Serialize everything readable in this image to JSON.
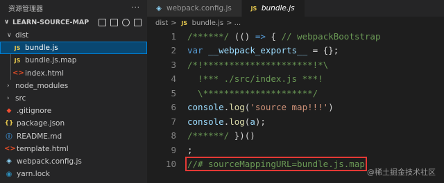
{
  "sidebar": {
    "title": "资源管理器",
    "more": "···",
    "project": "LEARN-SOURCE-MAP",
    "items": [
      {
        "label": "dist",
        "icon": "chevron-down-icon",
        "glyph": "∨"
      },
      {
        "label": "bundle.js",
        "icon": "js-file-icon",
        "glyph": "JS"
      },
      {
        "label": "bundle.js.map",
        "icon": "js-map-file-icon",
        "glyph": "JS"
      },
      {
        "label": "index.html",
        "icon": "html-file-icon",
        "glyph": "<>"
      },
      {
        "label": "node_modules",
        "icon": "chevron-right-icon",
        "glyph": "›"
      },
      {
        "label": "src",
        "icon": "chevron-right-icon",
        "glyph": "›"
      },
      {
        "label": ".gitignore",
        "icon": "git-icon",
        "glyph": "◆"
      },
      {
        "label": "package.json",
        "icon": "json-file-icon",
        "glyph": "{}"
      },
      {
        "label": "README.md",
        "icon": "markdown-file-icon",
        "glyph": "ⓘ"
      },
      {
        "label": "template.html",
        "icon": "html-file-icon",
        "glyph": "<>"
      },
      {
        "label": "webpack.config.js",
        "icon": "webpack-icon",
        "glyph": "◈"
      },
      {
        "label": "yarn.lock",
        "icon": "yarn-icon",
        "glyph": "◉"
      }
    ]
  },
  "tabs": [
    {
      "label": "webpack.config.js",
      "glyph": "◈",
      "active": false
    },
    {
      "label": "bundle.js",
      "glyph": "JS",
      "active": true
    }
  ],
  "breadcrumb": {
    "folder": "dist",
    "sep": ">",
    "file": "bundle.js",
    "more": "> ...",
    "glyph": "JS"
  },
  "code": {
    "lines": [
      {
        "n": "1",
        "parts": [
          [
            "c",
            "/******/ "
          ],
          [
            "p",
            "(() "
          ],
          [
            "k",
            "=>"
          ],
          [
            "p",
            " { "
          ],
          [
            "c",
            "// webpackBootstrap"
          ]
        ]
      },
      {
        "n": "2",
        "parts": [
          [
            "k",
            "var"
          ],
          [
            "p",
            " "
          ],
          [
            "v",
            "__webpack_exports__"
          ],
          [
            "p",
            " = {};"
          ]
        ]
      },
      {
        "n": "3",
        "parts": [
          [
            "c",
            "/*!*********************!*\\"
          ]
        ]
      },
      {
        "n": "4",
        "parts": [
          [
            "c",
            "  !*** ./src/index.js ***!"
          ]
        ]
      },
      {
        "n": "5",
        "parts": [
          [
            "c",
            "  \\*********************/"
          ]
        ]
      },
      {
        "n": "6",
        "parts": [
          [
            "v",
            "console"
          ],
          [
            "p",
            "."
          ],
          [
            "f",
            "log"
          ],
          [
            "p",
            "("
          ],
          [
            "s",
            "'source map!!!'"
          ],
          [
            "p",
            ")"
          ]
        ]
      },
      {
        "n": "7",
        "parts": [
          [
            "v",
            "console"
          ],
          [
            "p",
            "."
          ],
          [
            "f",
            "log"
          ],
          [
            "p",
            "("
          ],
          [
            "v",
            "a"
          ],
          [
            "p",
            ");"
          ]
        ]
      },
      {
        "n": "8",
        "parts": [
          [
            "c",
            "/******/ "
          ],
          [
            "p",
            "})()"
          ]
        ]
      },
      {
        "n": "9",
        "parts": [
          [
            "p",
            ";"
          ]
        ]
      },
      {
        "n": "10",
        "parts": [
          [
            "c",
            "//# sourceMappingURL=bundle.js.map"
          ]
        ],
        "highlight": true
      }
    ]
  },
  "watermark": "@稀土掘金技术社区",
  "colors": {
    "highlight_box": "#e53935",
    "selection": "#094771"
  }
}
